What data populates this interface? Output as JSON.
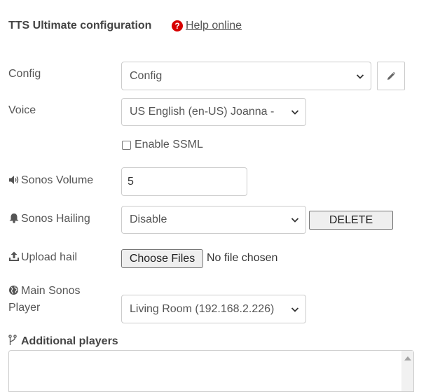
{
  "header": {
    "title": "TTS Ultimate configuration",
    "help_link": "Help online",
    "help_icon": "question-circle-icon"
  },
  "form": {
    "config": {
      "label": "Config",
      "value": "Config"
    },
    "voice": {
      "label": "Voice",
      "value": "US English (en-US) Joanna - "
    },
    "ssml": {
      "label": "Enable SSML",
      "checked": false
    },
    "volume": {
      "label": "Sonos Volume",
      "value": "5"
    },
    "hailing": {
      "label": "Sonos Hailing",
      "value": "Disable",
      "delete_label": "DELETE"
    },
    "upload": {
      "label": "Upload hail",
      "button_label": "Choose Files",
      "status": "No file chosen"
    },
    "main_player": {
      "label_line1": "Main Sonos",
      "label_line2": "Player",
      "value": "Living Room (192.168.2.226)"
    },
    "additional": {
      "label": "Additional players"
    }
  },
  "colors": {
    "help_icon": "#d70000",
    "text": "#555555",
    "border": "#cccccc"
  }
}
